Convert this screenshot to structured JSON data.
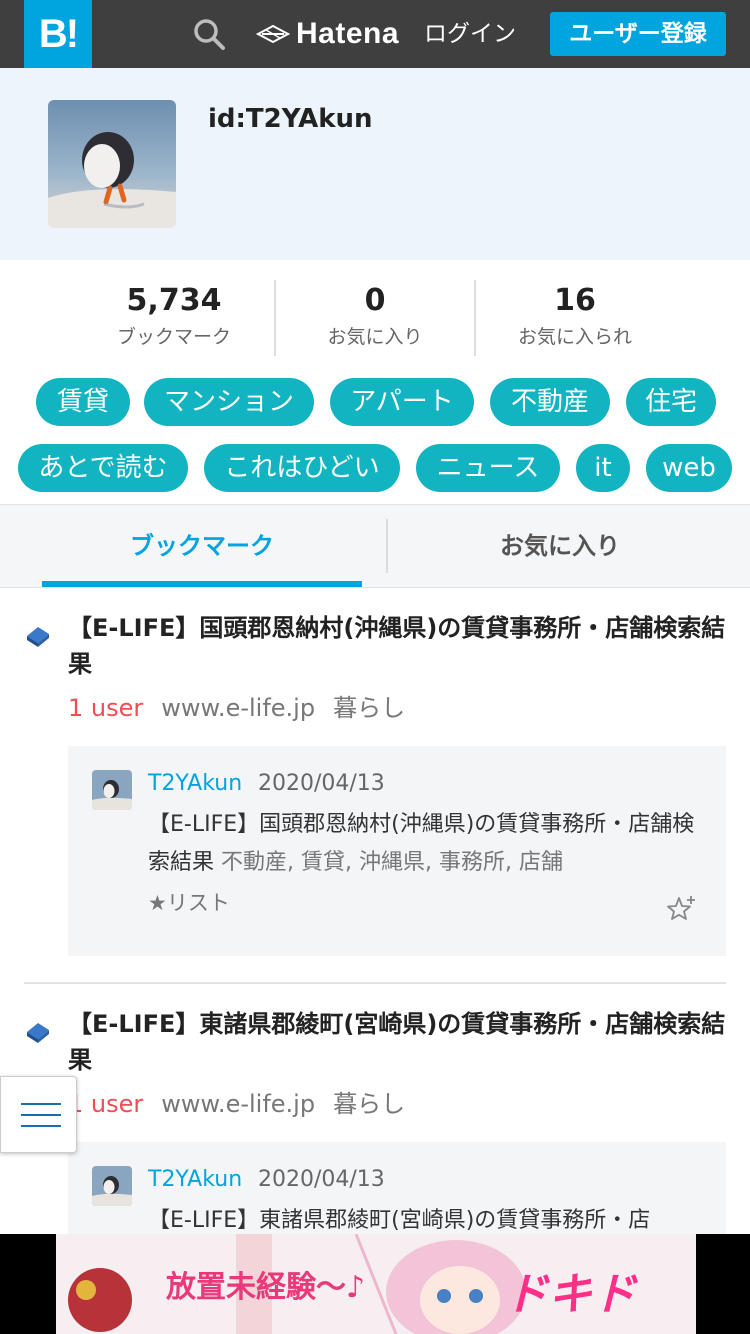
{
  "header": {
    "logo": "B!",
    "brand": "Hatena",
    "login": "ログイン",
    "register": "ユーザー登録"
  },
  "profile": {
    "user_id": "id:T2YAkun"
  },
  "stats": [
    {
      "value": "5,734",
      "label": "ブックマーク"
    },
    {
      "value": "0",
      "label": "お気に入り"
    },
    {
      "value": "16",
      "label": "お気に入られ"
    }
  ],
  "tags": [
    "賃貸",
    "マンション",
    "アパート",
    "不動産",
    "住宅",
    "あとで読む",
    "これはひどい",
    "ニュース",
    "it",
    "web"
  ],
  "tabs": {
    "active": "ブックマーク",
    "other": "お気に入り"
  },
  "entries": [
    {
      "title": "【E-LIFE】国頭郡恩納村(沖縄県)の賃貸事務所・店舗検索結果",
      "users": "1 user",
      "site": "www.e-life.jp",
      "category": "暮らし",
      "comment": {
        "user": "T2YAkun",
        "date": "2020/04/13",
        "text": "【E-LIFE】国頭郡恩納村(沖縄県)の賃貸事務所・店舗検索結果",
        "tags": "不動産, 賃貸, 沖縄県, 事務所, 店舗",
        "list": "★リスト"
      }
    },
    {
      "title": "【E-LIFE】東諸県郡綾町(宮崎県)の賃貸事務所・店舗検索結果",
      "users": "1 user",
      "site": "www.e-life.jp",
      "category": "暮らし",
      "comment": {
        "user": "T2YAkun",
        "date": "2020/04/13",
        "text": "【E-LIFE】東諸県郡綾町(宮崎県)の賃貸事務所・店",
        "tags": "",
        "list": ""
      }
    }
  ],
  "ad": {
    "text1": "放置未経験〜♪",
    "text2": "ドキドキ…"
  },
  "colors": {
    "accent": "#00a4de",
    "tag": "#11b4c0",
    "users": "#ef4c53"
  }
}
